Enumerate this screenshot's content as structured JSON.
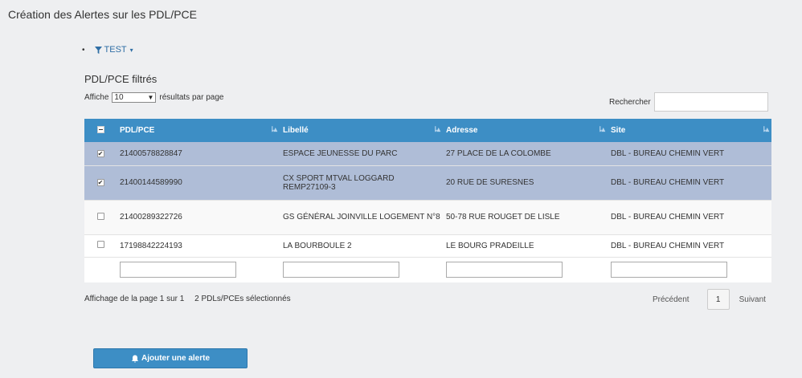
{
  "page": {
    "title": "Création des Alertes sur les PDL/PCE"
  },
  "filters": [
    {
      "label": "TEST"
    }
  ],
  "section": {
    "title": "PDL/PCE filtrés"
  },
  "length": {
    "prefix": "Affiche",
    "value": "10",
    "suffix": "résultats par page"
  },
  "search": {
    "label": "Rechercher",
    "value": ""
  },
  "table": {
    "columns": [
      "PDL/PCE",
      "Libellé",
      "Adresse",
      "Site"
    ],
    "rows": [
      {
        "checked": true,
        "pdl": "21400578828847",
        "libelle": "ESPACE JEUNESSE DU PARC",
        "adresse": "27 PLACE DE LA COLOMBE",
        "site": "DBL - BUREAU CHEMIN VERT"
      },
      {
        "checked": true,
        "pdl": "21400144589990",
        "libelle": "CX SPORT MTVAL LOGGARD REMP27109-3",
        "adresse": "20 RUE DE SURESNES",
        "site": "DBL - BUREAU CHEMIN VERT"
      },
      {
        "checked": false,
        "pdl": "21400289322726",
        "libelle": "GS GÉNÉRAL JOINVILLE LOGEMENT N°8",
        "adresse": "50-78 RUE ROUGET DE LISLE",
        "site": "DBL - BUREAU CHEMIN VERT"
      },
      {
        "checked": false,
        "pdl": "17198842224193",
        "libelle": "LA BOURBOULE 2",
        "adresse": "LE BOURG PRADEILLE",
        "site": "DBL - BUREAU CHEMIN VERT"
      }
    ]
  },
  "info": {
    "page_text": "Affichage de la page 1 sur 1",
    "selected_text": "2 PDLs/PCEs sélectionnés"
  },
  "pagination": {
    "previous": "Précédent",
    "current": "1",
    "next": "Suivant"
  },
  "actions": {
    "add_alert": "Ajouter une alerte"
  },
  "icons": {
    "filter": "funnel-icon",
    "add": "bell-icon",
    "sort": "sort-arrows-icon"
  },
  "colors": {
    "header": "#3d8ec5",
    "selected_row": "#afbdd7",
    "link": "#2f6ea5"
  }
}
